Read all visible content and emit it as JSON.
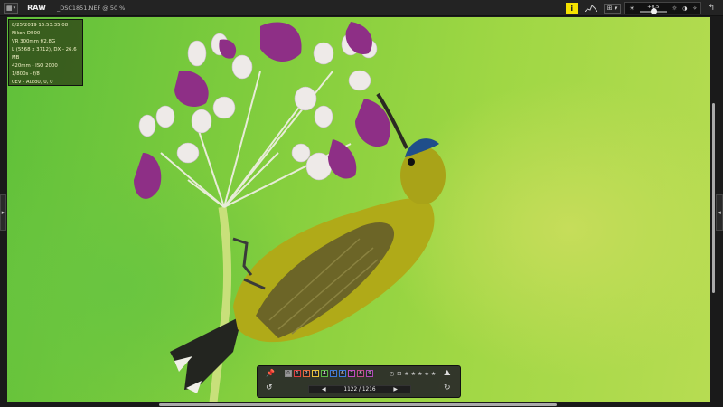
{
  "toolbar": {
    "view_mode_icon": "grid-dropdown-icon",
    "format_label": "RAW",
    "filename": "_DSC1851.NEF @ 50 %",
    "info_button_label": "i",
    "histogram_icon": "histogram-icon",
    "display_mode_label": "⊞ ▾",
    "exposure_value": "+0.5",
    "exit_icon": "return-icon"
  },
  "photo_info": {
    "lines": [
      "8/25/2019 16:53:35.08",
      "Nikon D500",
      "VR 300mm f/2.8G",
      "L (5568 x 3712), DX - 26.6 MB",
      "420mm - ISO 2000",
      "1/800s - f/8",
      "0EV - Auto0, 0, 0"
    ]
  },
  "control_panel": {
    "color_labels": [
      {
        "label": "0",
        "color": "#8a8a8a"
      },
      {
        "label": "1",
        "color": "#e04040"
      },
      {
        "label": "2",
        "color": "#e46a3c"
      },
      {
        "label": "3",
        "color": "#e8c23a"
      },
      {
        "label": "4",
        "color": "#5cb848"
      },
      {
        "label": "5",
        "color": "#3c7ad8"
      },
      {
        "label": "6",
        "color": "#3c7ad8"
      },
      {
        "label": "7",
        "color": "#c04ac0"
      },
      {
        "label": "8",
        "color": "#c04a8a"
      },
      {
        "label": "9",
        "color": "#b04ab8"
      }
    ],
    "rating": 0,
    "max_rating": 5,
    "position_text": "1122 / 1216"
  }
}
